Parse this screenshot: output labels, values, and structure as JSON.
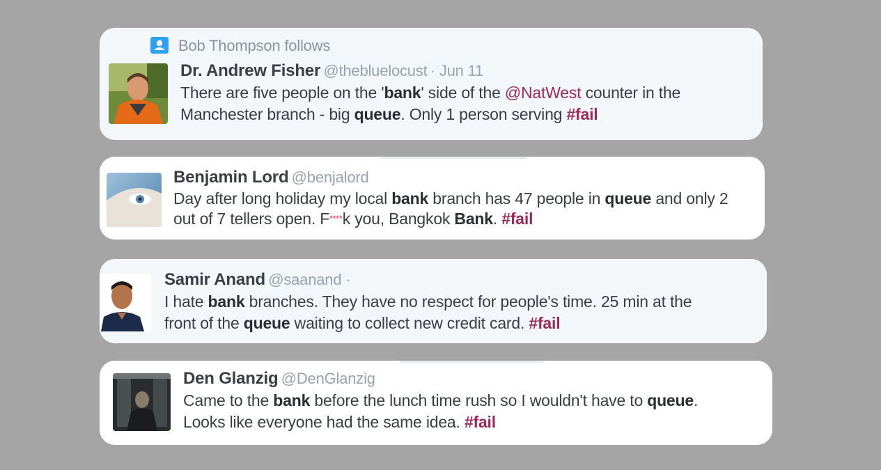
{
  "colors": {
    "background": "#a5a5a5",
    "card_light": "#f4f7fa",
    "card_white": "#ffffff",
    "hashtag": "#9b2a5c",
    "follows_icon": "#2ea1f2"
  },
  "tweets": [
    {
      "context": "Bob Thompson follows",
      "context_icon": "person-badge-icon",
      "name": "Dr. Andrew Fisher",
      "handle": "@thebluelocust",
      "date": "· Jun 11",
      "line1": {
        "t1": "There are five people on the '",
        "b1": "bank",
        "t2": "' side of the ",
        "mention": "@NatWest",
        "t3": " counter in the"
      },
      "line2": {
        "t1": "Manchester branch - big ",
        "b1": "queue",
        "t2": ". Only 1 person serving ",
        "tag": "#fail"
      }
    },
    {
      "name": "Benjamin Lord",
      "handle": "@benjalord",
      "line1": {
        "t1": "Day after long holiday my local ",
        "b1": "bank",
        "t2": " branch has 47 people in ",
        "b2": "queue",
        "t3": " and only 2"
      },
      "line2": {
        "t1": "out of 7 tellers open. F",
        "stars": "****",
        "t2": "k you, Bangkok ",
        "b1": "Bank",
        "t3": ". ",
        "tag": "#fail"
      }
    },
    {
      "name": "Samir Anand",
      "handle": "@saanand ·",
      "line1": {
        "t1": "I hate ",
        "b1": "bank",
        "t2": " branches. They have no respect for people's time. 25 min at the"
      },
      "line2": {
        "t1": "front of the ",
        "b1": "queue",
        "t2": " waiting to collect new credit card. ",
        "tag": "#fail"
      }
    },
    {
      "name": "Den Glanzig",
      "handle": "@DenGlanzig",
      "line1": {
        "t1": "Came to the ",
        "b1": "bank",
        "t2": " before the lunch time rush so I wouldn't have to ",
        "b2": "queue",
        "t3": "."
      },
      "line2": {
        "t1": "Looks like everyone had the same idea. ",
        "tag": "#fail"
      }
    }
  ]
}
